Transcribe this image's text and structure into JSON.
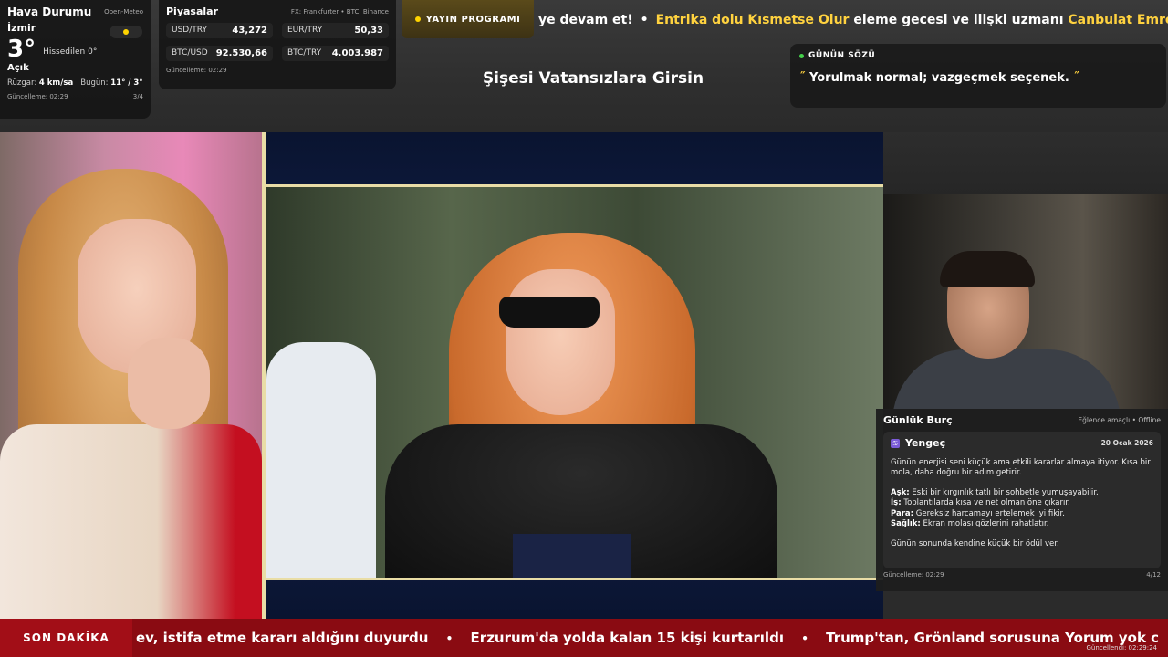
{
  "weather": {
    "title": "Hava Durumu",
    "source": "Open-Meteo",
    "city": "İzmir",
    "temp": "3°",
    "feels": "Hissedilen 0°",
    "condition": "Açık",
    "wind_label": "Rüzgar:",
    "wind_value": "4 km/sa",
    "today_label": "Bugün:",
    "today_value": "11° / 3°",
    "updated": "Güncelleme: 02:29",
    "page": "3/4"
  },
  "markets": {
    "title": "Piyasalar",
    "source": "FX: Frankfurter • BTC: Binance",
    "items": [
      {
        "label": "USD/TRY",
        "value": "43,272"
      },
      {
        "label": "EUR/TRY",
        "value": "50,33"
      },
      {
        "label": "BTC/USD",
        "value": "92.530,66"
      },
      {
        "label": "BTC/TRY",
        "value": "4.003.987"
      }
    ],
    "updated": "Güncelleme: 02:29"
  },
  "program": {
    "label": "YAYIN PROGRAMI"
  },
  "top_ticker": {
    "part1": "ye devam et!",
    "sep": "•",
    "hl1": "Entrika dolu Kısmetse Olur",
    "part2": " eleme gecesi ve ilişki uzmanı ",
    "hl2": "Canbulat Emre"
  },
  "show_title": "Şişesi Vatansızlara Girsin",
  "quote": {
    "heading": "GÜNÜN SÖZÜ",
    "open": "˝",
    "text": "Yorulmak normal; vazgeçmek seçenek.",
    "close": "˝"
  },
  "horoscope": {
    "title": "Günlük Burç",
    "meta": "Eğlence amaçlı • Offline",
    "sign": "Yengeç",
    "date": "20 Ocak 2026",
    "intro": "Günün enerjisi seni küçük ama etkili kararlar almaya itiyor. Kısa bir mola, daha doğru bir adım getirir.",
    "love_label": "Aşk:",
    "love": " Eski bir kırgınlık tatlı bir sohbetle yumuşayabilir.",
    "work_label": "İş:",
    "work": " Toplantılarda kısa ve net olman öne çıkarır.",
    "money_label": "Para:",
    "money": " Gereksiz harcamayı ertelemek iyi fikir.",
    "health_label": "Sağlık:",
    "health": " Ekran molası gözlerini rahatlatır.",
    "closing": "Günün sonunda kendine küçük bir ödül ver.",
    "updated": "Güncelleme: 02:29",
    "page": "4/12"
  },
  "bottom_ticker": {
    "badge": "SON DAKİKA",
    "items": [
      "ev, istifa etme kararı aldığını duyurdu",
      "Erzurum'da yolda kalan 15 kişi kurtarıldı",
      "Trump'tan, Grönland sorusuna Yorum yok c"
    ],
    "sep": "•",
    "updated": "Güncellendi: 02:29:24"
  }
}
